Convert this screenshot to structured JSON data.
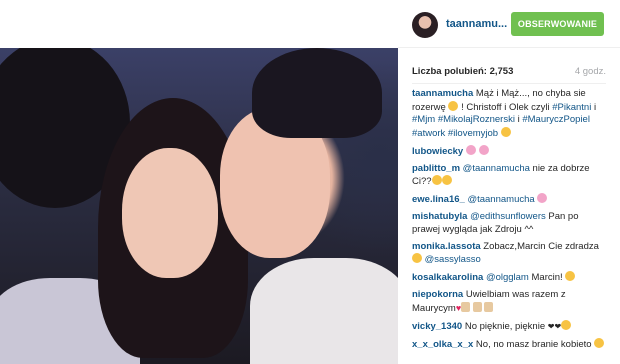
{
  "post": {
    "username": "taannamu...",
    "follow_label": "OBSERWOWANIE",
    "likes_text": "Liczba polubień: 2,753",
    "time_text": "4 godz."
  },
  "comments": [
    {
      "user": "taannamucha",
      "parts": [
        "Mąż i Mąż..., no chyba sie rozerwę",
        " ! Christoff i Olek czyli ",
        "#Pikantni",
        " i ",
        "#Mjm",
        " ",
        "#MikolajRoznerski",
        " i ",
        "#MauryczPopiel",
        " ",
        "#atwork",
        " ",
        "#ilovemyjob"
      ]
    },
    {
      "user": "lubowiecky"
    },
    {
      "user": "pablitto_m",
      "mention": "@taannamucha",
      "text": " nie za dobrze Ci??"
    },
    {
      "user": "ewe.lina16_",
      "mention": "@taannamucha"
    },
    {
      "user": "mishatubyla",
      "mention": "@edithsunflowers",
      "text": " Pan po prawej wygląda jak Zdroju ^^"
    },
    {
      "user": "monika.lassota",
      "text": " Zobacz,Marcin Cie zdradza",
      "mention": "@sassylasso"
    },
    {
      "user": "kosalkakarolina",
      "mention": "@olgglam",
      "text": " Marcin!"
    },
    {
      "user": "niepokorna",
      "text": " Uwielbiam was razem z Maurycym"
    },
    {
      "user": "vicky_1340",
      "text": " No pięknie, pięknie"
    },
    {
      "user": "x_x_olka_x_x",
      "text": " No, no masz branie kobieto"
    }
  ],
  "icons": {
    "emoji": "smiley-emoji-icon",
    "heart": "heart-emoji-icon",
    "hand": "hand-emoji-icon"
  },
  "colors": {
    "link": "#125688",
    "follow": "#70c050"
  }
}
